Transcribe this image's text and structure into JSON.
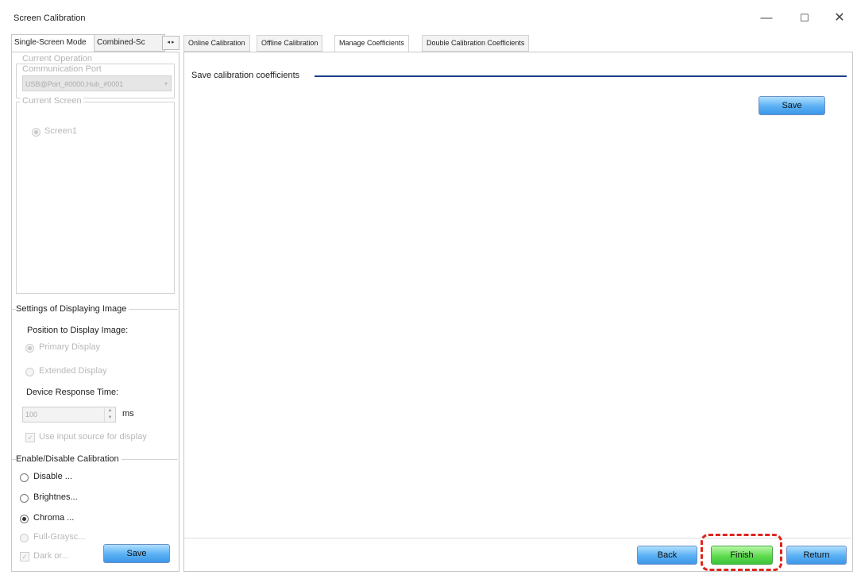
{
  "window": {
    "title": "Screen Calibration",
    "minimize_glyph": "—",
    "maximize_glyph": "☐",
    "close_glyph": "✕"
  },
  "left_tabs": {
    "single_screen": "Single-Screen Mode",
    "combined": "Combined-Sc",
    "arrows": "◂ ▸"
  },
  "operation": {
    "legend_line1": "Current Operation",
    "legend_line2": "Communication Port",
    "port_value": "USB@Port_#0000.Hub_#0001"
  },
  "current_screen": {
    "legend": "Current Screen",
    "screen": "Screen1"
  },
  "display_settings": {
    "legend": "Settings of Displaying Image",
    "position_label": "Position to Display Image:",
    "primary": "Primary Display",
    "extended": "Extended Display",
    "response_label": "Device Response Time:",
    "response_value": "100",
    "unit": "ms",
    "use_input": "Use input source for display"
  },
  "calibration_toggle": {
    "legend": "Enable/Disable Calibration",
    "disable": "Disable ...",
    "brightness": "Brightnes...",
    "chroma": "Chroma ...",
    "full_grayscale": "Full-Graysc...",
    "dark_or": "Dark or...",
    "save": "Save"
  },
  "right_tabs": {
    "online": "Online Calibration",
    "offline": "Offline Calibration",
    "manage": "Manage Coefficients",
    "double": "Double Calibration Coefficients"
  },
  "manage": {
    "section_label": "Save calibration coefficients",
    "save": "Save"
  },
  "footer": {
    "back": "Back",
    "finish": "Finish",
    "return": "Return"
  },
  "colors": {
    "accent_blue": "#3d97e8",
    "finish_green": "#3cc23a",
    "highlight_red": "#e0241c"
  }
}
